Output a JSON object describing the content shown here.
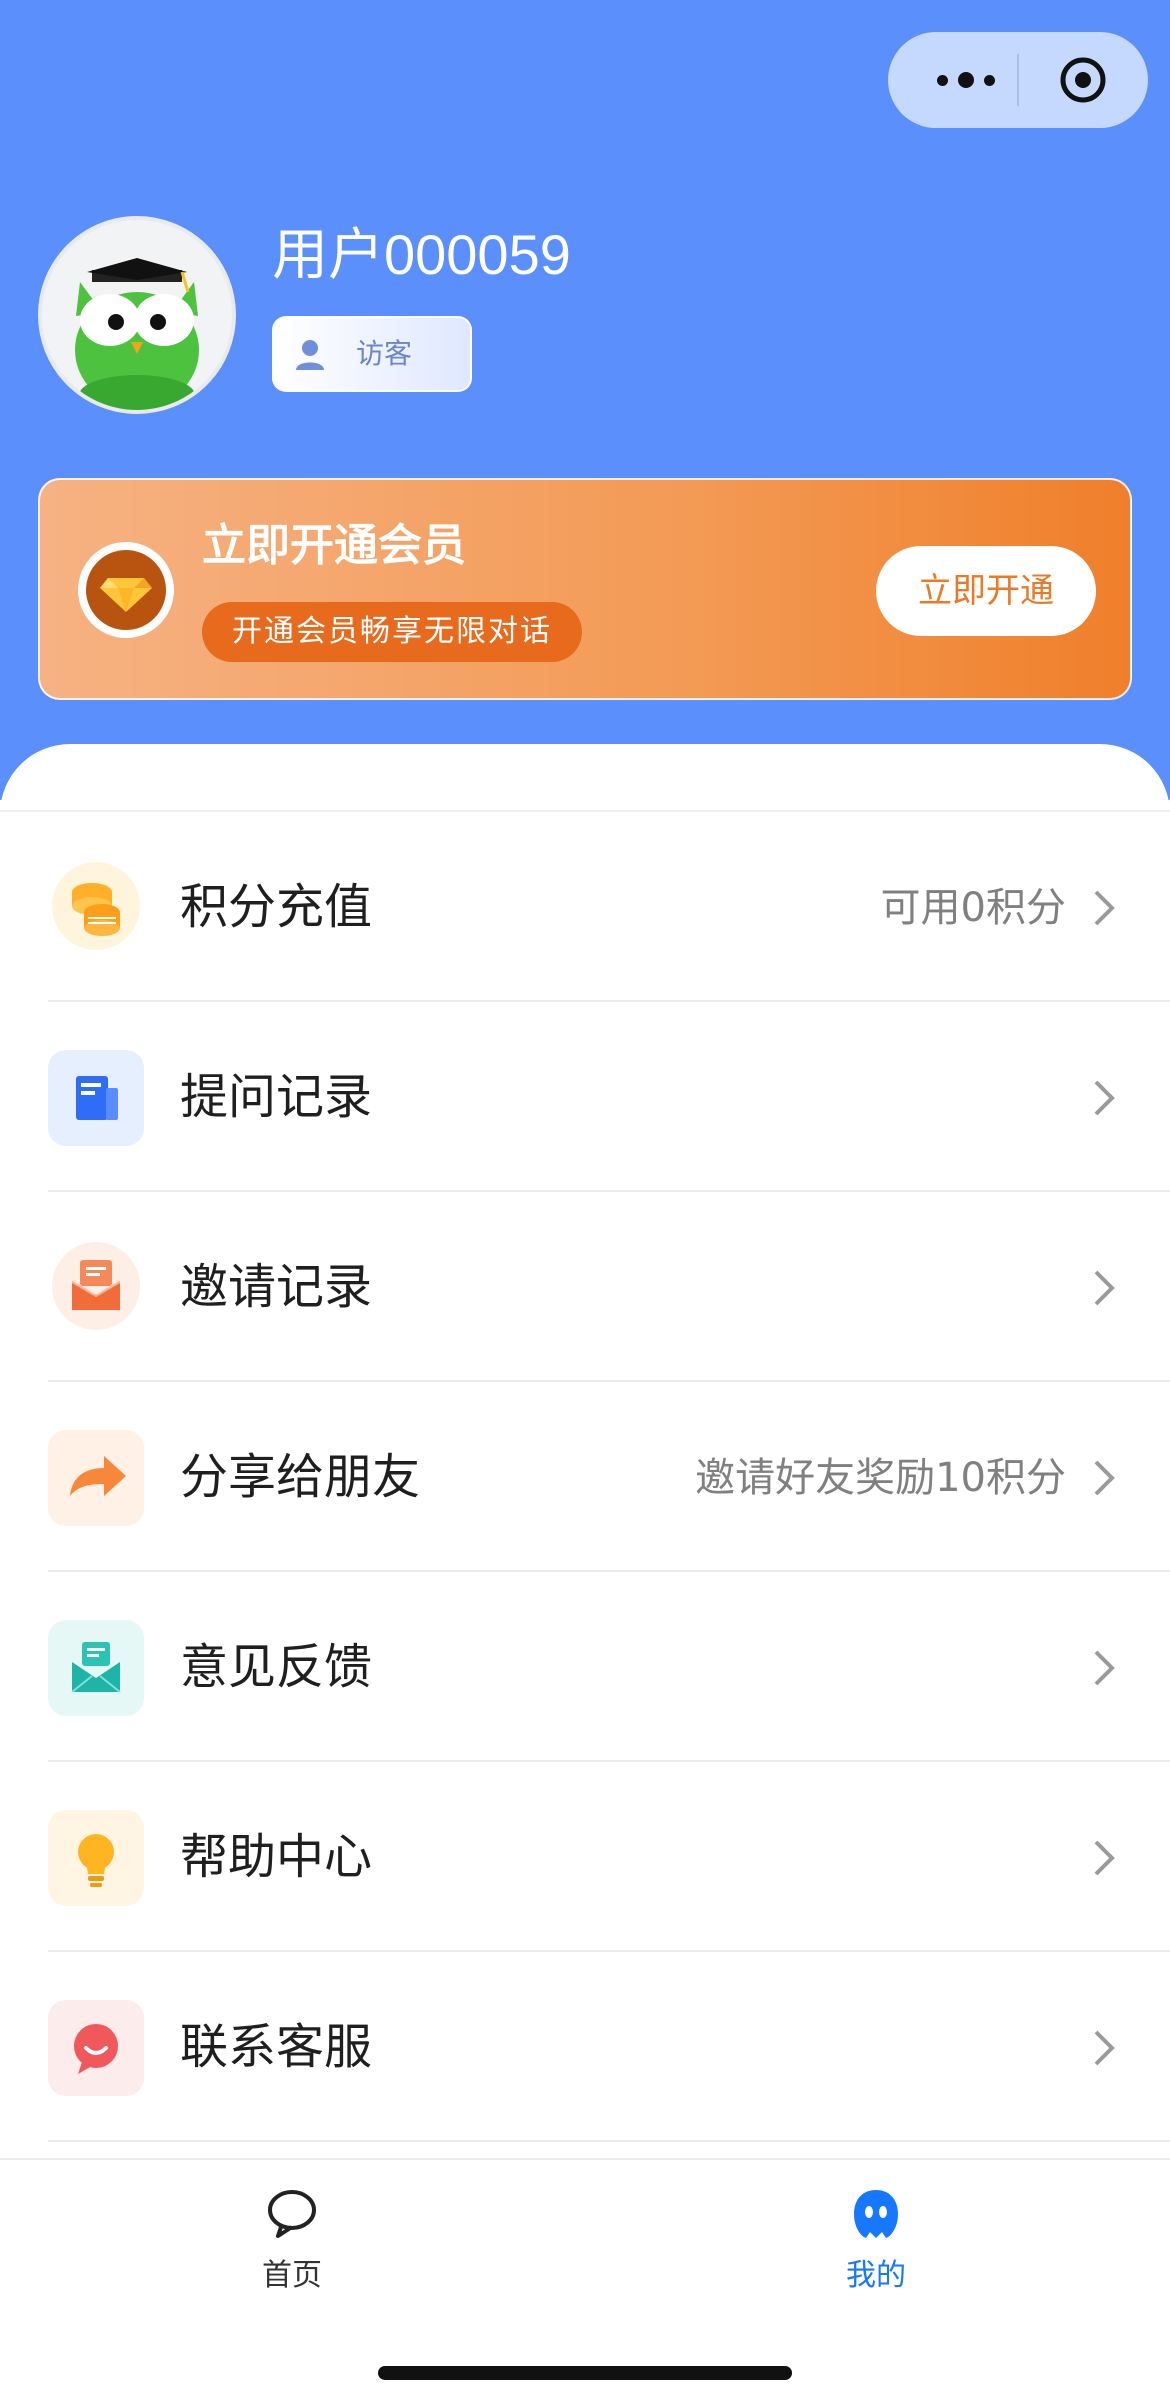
{
  "colors": {
    "header_blue": "#5B8FFB",
    "vip_orange": "#F08A3C",
    "vip_button_text": "#EA7A26",
    "active_tab": "#1677FF",
    "inactive_tab": "#333333",
    "chevron": "#9a9a9a"
  },
  "capsule": {
    "more_icon": "more-dots-icon",
    "close_icon": "target-circle-icon"
  },
  "profile": {
    "username": "用户000059",
    "role": "访客",
    "avatar_icon": "owl-graduate-icon"
  },
  "vip": {
    "title": "立即开通会员",
    "subtitle": "开通会员畅享无限对话",
    "button": "立即开通",
    "icon": "diamond-icon"
  },
  "menu": [
    {
      "label": "积分充值",
      "value": "可用0积分",
      "icon": "coins-icon",
      "icon_bg": "#FFF4DC"
    },
    {
      "label": "提问记录",
      "value": "",
      "icon": "document-icon",
      "icon_bg": "#E6EFFE"
    },
    {
      "label": "邀请记录",
      "value": "",
      "icon": "envelope-icon",
      "icon_bg": "#FDEFE6"
    },
    {
      "label": "分享给朋友",
      "value": "邀请好友奖励10积分",
      "icon": "share-arrow-icon",
      "icon_bg": "#FFF1E6"
    },
    {
      "label": "意见反馈",
      "value": "",
      "icon": "feedback-mail-icon",
      "icon_bg": "#E5F8F6"
    },
    {
      "label": "帮助中心",
      "value": "",
      "icon": "lightbulb-icon",
      "icon_bg": "#FFF5E2"
    },
    {
      "label": "联系客服",
      "value": "",
      "icon": "chat-bubble-icon",
      "icon_bg": "#FDECEC"
    }
  ],
  "tabs": [
    {
      "label": "首页",
      "icon": "chat-outline-icon",
      "active": false
    },
    {
      "label": "我的",
      "icon": "profile-face-icon",
      "active": true
    }
  ]
}
